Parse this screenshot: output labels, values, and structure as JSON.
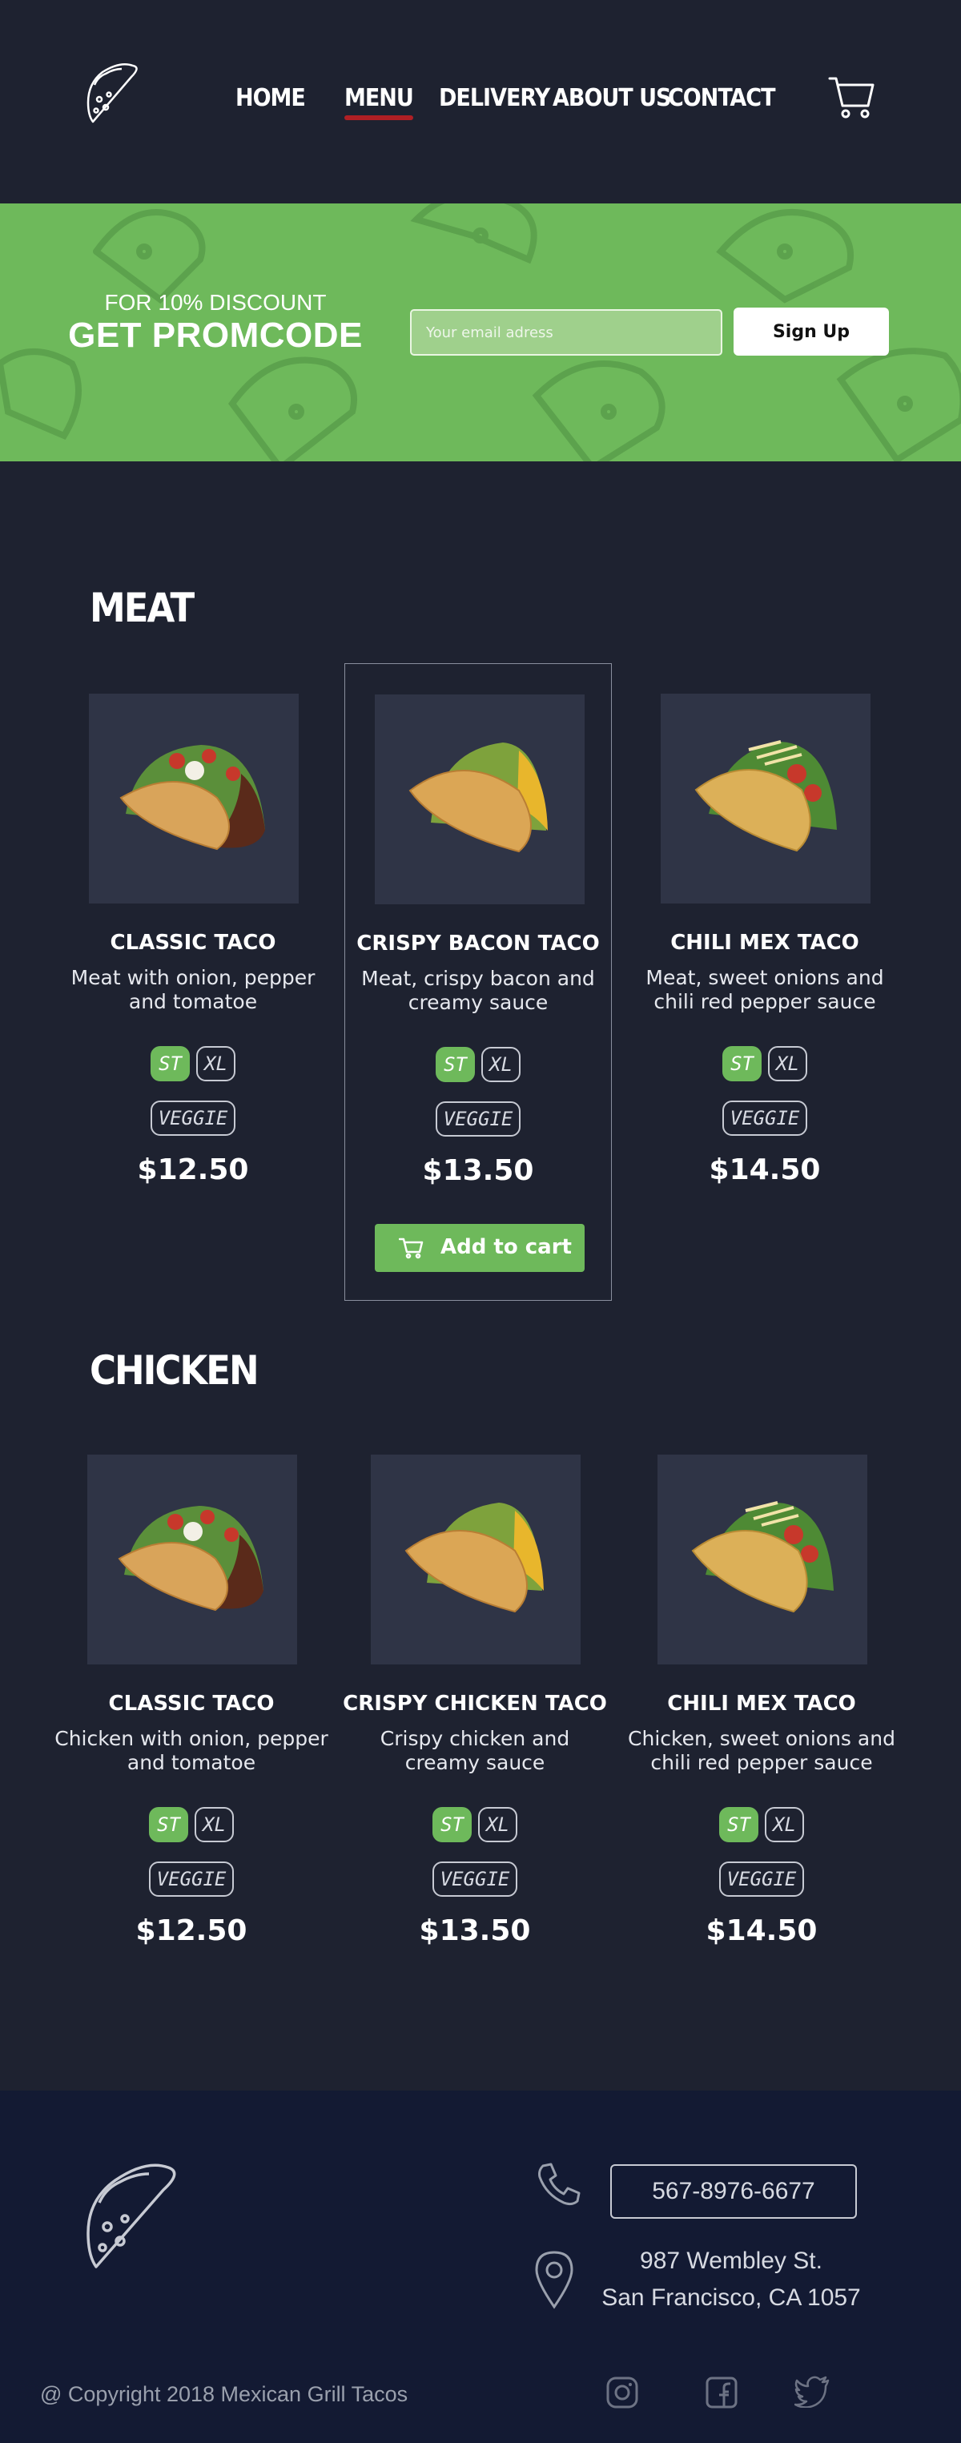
{
  "nav": {
    "items": [
      {
        "label": "HOME",
        "active": false
      },
      {
        "label": "MENU",
        "active": true
      },
      {
        "label": "DELIVERY",
        "active": false
      },
      {
        "label": "ABOUT US",
        "active": false
      },
      {
        "label": "CONTACT",
        "active": false
      }
    ]
  },
  "promo": {
    "small": "FOR 10% DISCOUNT",
    "big": "GET PROMCODE",
    "email_placeholder": "Your email adress",
    "signup_label": "Sign Up"
  },
  "sections": [
    {
      "title": "MEAT",
      "items": [
        {
          "name": "CLASSIC TACO",
          "desc": "Meat with onion, pepper and tomatoe",
          "sizes": [
            "ST",
            "XL"
          ],
          "selected": "ST",
          "tag": "VEGGIE",
          "price": "$12.50"
        },
        {
          "name": "CRISPY BACON TACO",
          "desc": "Meat, crispy bacon and creamy sauce",
          "sizes": [
            "ST",
            "XL"
          ],
          "selected": "ST",
          "tag": "VEGGIE",
          "price": "$13.50"
        },
        {
          "name": "CHILI MEX TACO",
          "desc": "Meat, sweet onions and chili red pepper sauce",
          "sizes": [
            "ST",
            "XL"
          ],
          "selected": "ST",
          "tag": "VEGGIE",
          "price": "$14.50"
        }
      ],
      "add_to_cart_label": "Add to cart"
    },
    {
      "title": "CHICKEN",
      "items": [
        {
          "name": "CLASSIC TACO",
          "desc": "Chicken with onion, pepper and tomatoe",
          "sizes": [
            "ST",
            "XL"
          ],
          "selected": "ST",
          "tag": "VEGGIE",
          "price": "$12.50"
        },
        {
          "name": "CRISPY CHICKEN TACO",
          "desc": "Crispy chicken and creamy sauce",
          "sizes": [
            "ST",
            "XL"
          ],
          "selected": "ST",
          "tag": "VEGGIE",
          "price": "$13.50"
        },
        {
          "name": "CHILI MEX TACO",
          "desc": "Chicken, sweet onions and chili red pepper sauce",
          "sizes": [
            "ST",
            "XL"
          ],
          "selected": "ST",
          "tag": "VEGGIE",
          "price": "$14.50"
        }
      ]
    }
  ],
  "footer": {
    "phone": "567-8976-6677",
    "address_line1": "987 Wembley St.",
    "address_line2": "San Francisco, CA 1057",
    "copyright": "@ Copyright 2018 Mexican Grill Tacos",
    "social": [
      "instagram-icon",
      "facebook-icon",
      "twitter-icon"
    ]
  },
  "colors": {
    "background": "#1e2230",
    "accent_green": "#6eb95b",
    "nav_active_underline": "#b01f24",
    "footer_bg": "#131a33"
  }
}
